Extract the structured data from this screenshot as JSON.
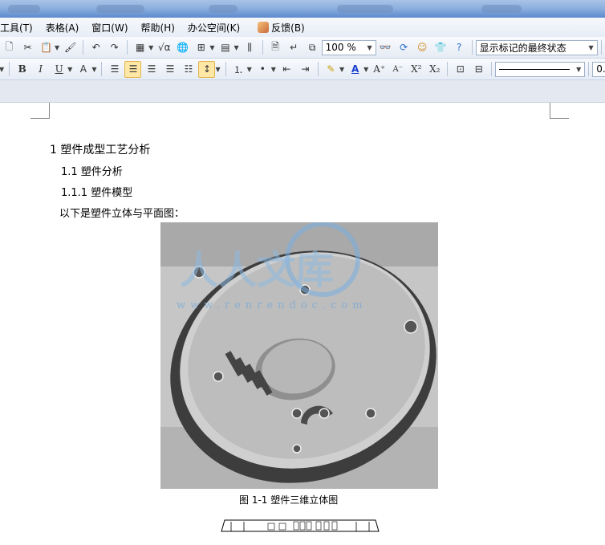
{
  "menubar": {
    "items": [
      {
        "label": "工具(T)",
        "name": "menu-tools"
      },
      {
        "label": "表格(A)",
        "name": "menu-table"
      },
      {
        "label": "窗口(W)",
        "name": "menu-window"
      },
      {
        "label": "帮助(H)",
        "name": "menu-help"
      },
      {
        "label": "办公空间(K)",
        "name": "menu-office-space"
      },
      {
        "label": "反馈(B)",
        "name": "menu-feedback"
      }
    ]
  },
  "toolbar1": {
    "zoom_value": "100 %",
    "track_changes_value": "显示标记的最终状态",
    "show_label": "显示"
  },
  "toolbar2": {
    "bold": "B",
    "italic": "I",
    "underline": "U",
    "font_size_value": "0."
  },
  "document": {
    "heading1": "1  塑件成型工艺分析",
    "heading2": "1.1 塑件分析",
    "heading3": "1.1.1 塑件模型",
    "paragraph": "以下是塑件立体与平面图：",
    "figure_caption": "图 1-1    塑件三维立体图",
    "watermark_url": "www.renrendoc.com",
    "watermark_brand": "人人文库"
  }
}
